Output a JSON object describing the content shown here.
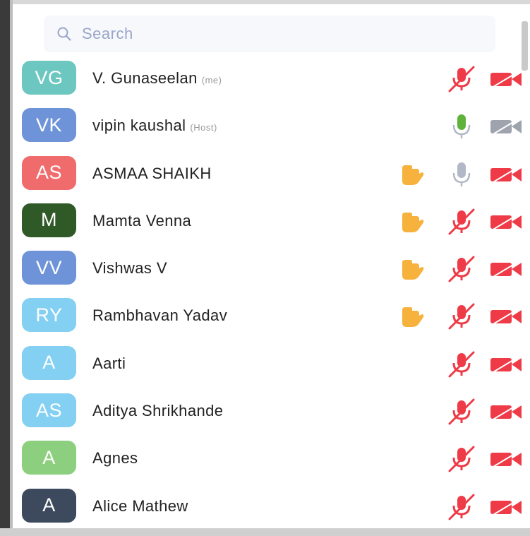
{
  "search": {
    "placeholder": "Search",
    "icon": "search-icon"
  },
  "colors": {
    "muted_red": "#ef3b47",
    "mic_green": "#5fb33a",
    "mic_grey": "#b3b8c8",
    "cam_grey": "#9ea3ae",
    "hand_orange": "#f6b23c"
  },
  "participants": [
    {
      "initials": "VG",
      "name": "V. Gunaseelan",
      "tag": "(me)",
      "color": "#6cc7c0",
      "hand": false,
      "mic": "muted",
      "video": "off"
    },
    {
      "initials": "VK",
      "name": "vipin kaushal",
      "tag": "(Host)",
      "color": "#6e93d8",
      "hand": false,
      "mic": "on",
      "video": "off-grey"
    },
    {
      "initials": "AS",
      "name": "ASMAA SHAIKH",
      "tag": "",
      "color": "#f06c6c",
      "hand": true,
      "mic": "idle",
      "video": "off"
    },
    {
      "initials": "M",
      "name": "Mamta Venna",
      "tag": "",
      "color": "#2f5a27",
      "hand": true,
      "mic": "muted",
      "video": "off"
    },
    {
      "initials": "VV",
      "name": "Vishwas V",
      "tag": "",
      "color": "#6e93d8",
      "hand": true,
      "mic": "muted",
      "video": "off"
    },
    {
      "initials": "RY",
      "name": "Rambhavan Yadav",
      "tag": "",
      "color": "#83d0f2",
      "hand": true,
      "mic": "muted",
      "video": "off"
    },
    {
      "initials": "A",
      "name": "Aarti",
      "tag": "",
      "color": "#83d0f2",
      "hand": false,
      "mic": "muted",
      "video": "off"
    },
    {
      "initials": "AS",
      "name": "Aditya Shrikhande",
      "tag": "",
      "color": "#83d0f2",
      "hand": false,
      "mic": "muted",
      "video": "off"
    },
    {
      "initials": "A",
      "name": "Agnes",
      "tag": "",
      "color": "#8ccf7e",
      "hand": false,
      "mic": "muted",
      "video": "off"
    },
    {
      "initials": "A",
      "name": "Alice Mathew",
      "tag": "",
      "color": "#3d4a5e",
      "hand": false,
      "mic": "muted",
      "video": "off"
    }
  ]
}
